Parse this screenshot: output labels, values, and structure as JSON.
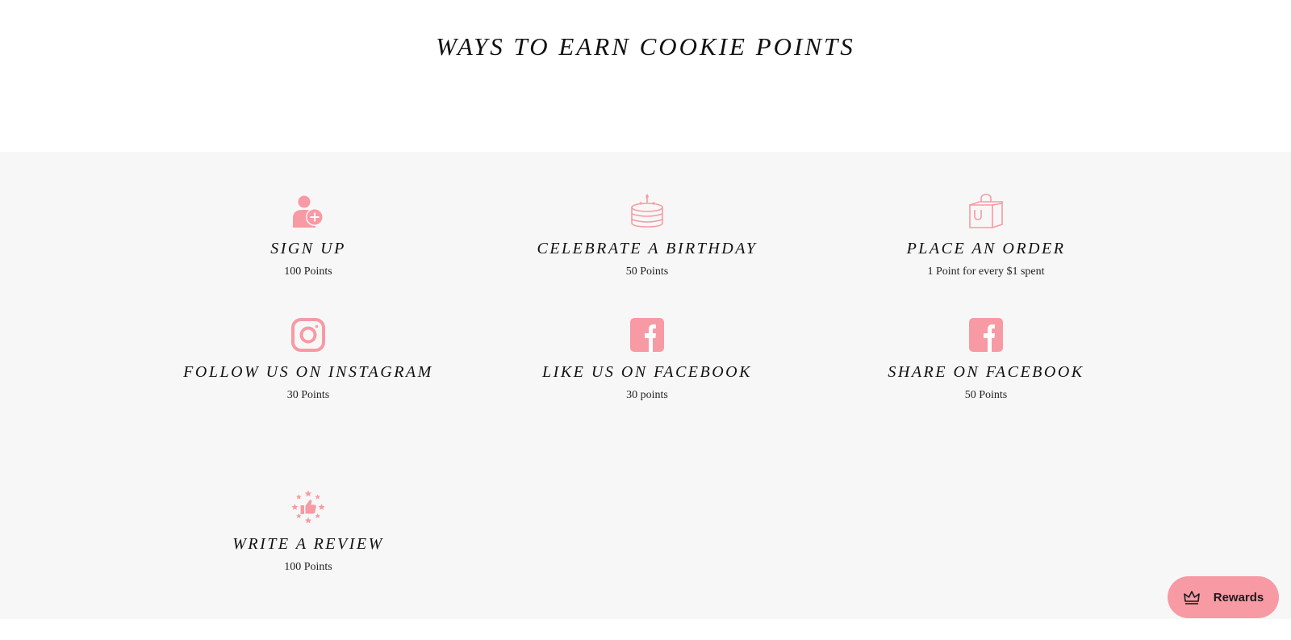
{
  "page": {
    "title": "WAYS TO EARN COOKIE POINTS"
  },
  "colors": {
    "accent": "#f79aa4",
    "section_background": "#f8f7f7",
    "text": "#111111"
  },
  "earn_items": [
    {
      "icon": "user-plus-icon",
      "title": "SIGN UP",
      "points": "100 Points"
    },
    {
      "icon": "birthday-cake-icon",
      "title": "CELEBRATE A BIRTHDAY",
      "points": "50 Points"
    },
    {
      "icon": "shopping-bag-icon",
      "title": "PLACE AN ORDER",
      "points": "1 Point for every $1 spent"
    },
    {
      "icon": "instagram-icon",
      "title": "FOLLOW US ON INSTAGRAM",
      "points": "30 Points"
    },
    {
      "icon": "facebook-icon",
      "title": "LIKE US ON FACEBOOK",
      "points": "30 points"
    },
    {
      "icon": "facebook-icon",
      "title": "SHARE ON FACEBOOK",
      "points": "50 Points"
    },
    {
      "icon": "thumbs-up-stars-icon",
      "title": "WRITE A REVIEW",
      "points": "100 Points"
    }
  ],
  "rewards_launcher": {
    "label": "Rewards",
    "icon": "crown-icon"
  }
}
